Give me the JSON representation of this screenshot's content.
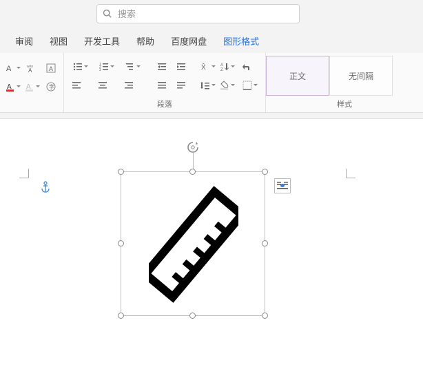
{
  "search": {
    "placeholder": "搜索"
  },
  "tabs": {
    "review": "审阅",
    "view": "视图",
    "developer": "开发工具",
    "help": "帮助",
    "baidu": "百度网盘",
    "shape_format": "图形格式"
  },
  "ribbon": {
    "paragraph_label": "段落",
    "styles_label": "样式",
    "style_normal": "正文",
    "style_nospace": "无间隔"
  }
}
